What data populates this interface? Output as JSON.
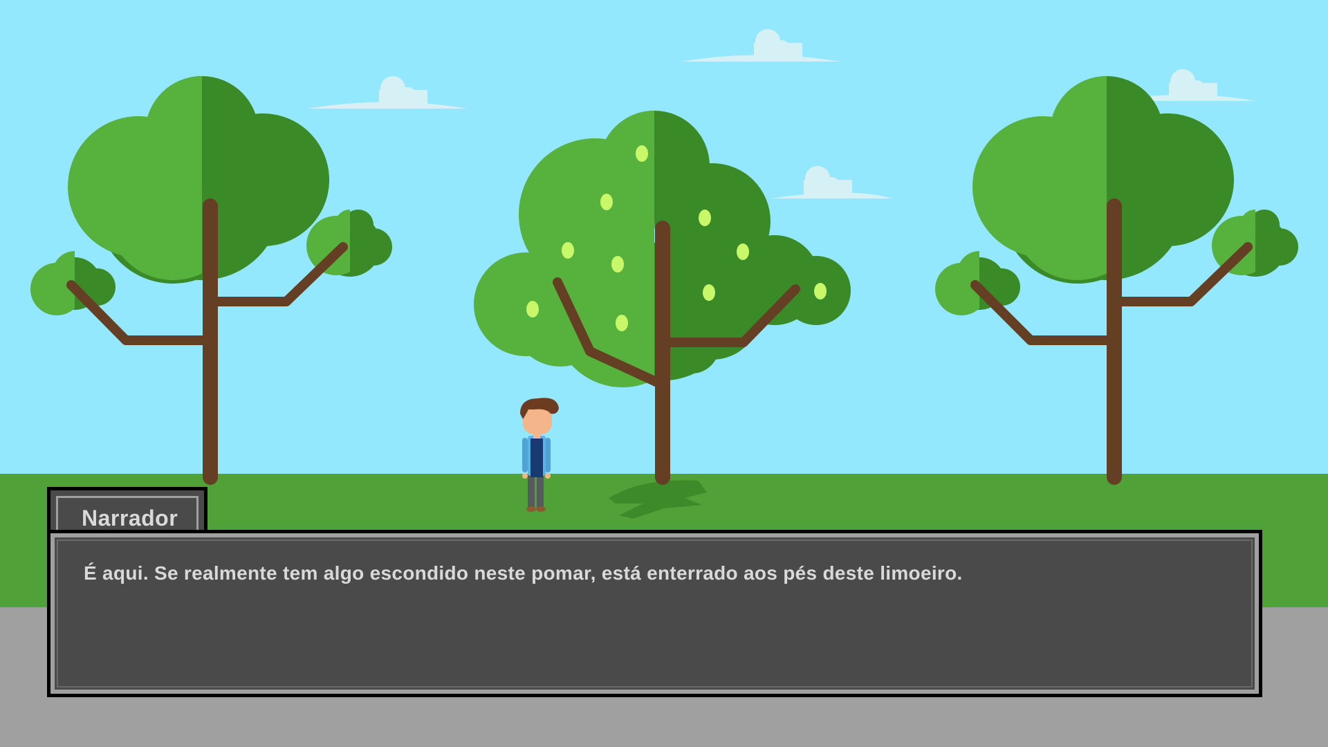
{
  "dialogue": {
    "speaker": "Narrador",
    "text": "É aqui. Se realmente tem algo escondido neste pomar, está enterrado aos pés deste limoeiro."
  },
  "colors": {
    "sky": "#94e8fd",
    "grass": "#50a137",
    "ground": "#a0a0a0",
    "leaf_light": "#56b13d",
    "leaf_dark": "#3a8a28",
    "trunk": "#653f24",
    "lemon": "#c8f76a",
    "cloud": "#d6f1f5"
  }
}
